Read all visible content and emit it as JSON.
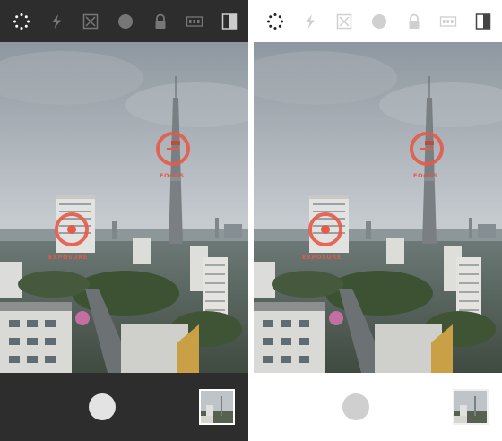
{
  "panels": [
    {
      "theme": "dark",
      "reticles": {
        "focus_label": "FOCUS",
        "exposure_label": "EXPOSURE"
      },
      "toolbar_icons": [
        "spinner-icon",
        "flash-icon",
        "grid-icon",
        "circle-icon",
        "lock-icon",
        "iso-icon",
        "split-icon"
      ]
    },
    {
      "theme": "light",
      "reticles": {
        "focus_label": "FOCUS",
        "exposure_label": "EXPOSURE"
      },
      "toolbar_icons": [
        "spinner-icon",
        "flash-icon",
        "grid-icon",
        "circle-icon",
        "lock-icon",
        "iso-icon",
        "split-icon"
      ]
    }
  ],
  "colors": {
    "dark_bar": "#2d2d2d",
    "light_bar": "#ffffff",
    "accent": "#e65a48",
    "dark_icon": "#777777",
    "dark_icon_active": "#ffffff",
    "light_icon": "#d0d0d0",
    "light_icon_active": "#222222"
  }
}
